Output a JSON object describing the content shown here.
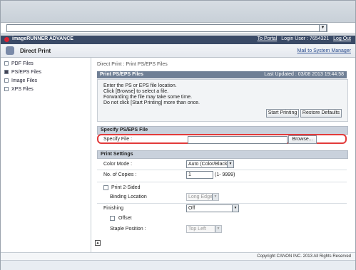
{
  "header": {
    "brand": "imageRUNNER ADVANCE",
    "portal": "To Portal",
    "login": "Login User : 7654321",
    "logout": "Log Out"
  },
  "subheader": {
    "title": "Direct Print",
    "mail": "Mail to System Manager"
  },
  "sidebar": {
    "items": [
      {
        "label": "PDF Files"
      },
      {
        "label": "PS/EPS Files"
      },
      {
        "label": "Image Files"
      },
      {
        "label": "XPS Files"
      }
    ]
  },
  "breadcrumb": "Direct Print : Print PS/EPS Files",
  "panel": {
    "title": "Print PS/EPS Files",
    "updated": "Last Updated : 03/08 2013 19:44:58",
    "notes": [
      "Enter the PS or EPS file location.",
      "Click [Browse] to select a file.",
      "Forwarding the file may take some time.",
      "Do not click [Start Printing] more than once."
    ],
    "start_btn": "Start Printing",
    "restore_btn": "Restore Defaults"
  },
  "specify": {
    "section_title": "Specify PS/EPS File",
    "label": "Specify File :",
    "browse_btn": "Browse..."
  },
  "settings": {
    "section_title": "Print Settings",
    "color_mode_label": "Color Mode :",
    "color_mode_value": "Auto (Color/Black)",
    "copies_label": "No. of Copies :",
    "copies_value": "1",
    "copies_range": "(1- 9999)",
    "two_sided_label": "Print 2-Sided",
    "binding_label": "Binding Location",
    "binding_value": "Long Edge",
    "finishing_label": "Finishing",
    "finishing_value": "Off",
    "offset_label": "Offset",
    "staple_label": "Staple Position :",
    "staple_value": "Top Left"
  },
  "footer": {
    "copyright": "Copyright CANON INC. 2013 All Rights Reserved"
  },
  "colors": {
    "header_bg": "#3a4a66",
    "panel_title_bg": "#6f7f95",
    "highlight": "#e23a3a"
  }
}
